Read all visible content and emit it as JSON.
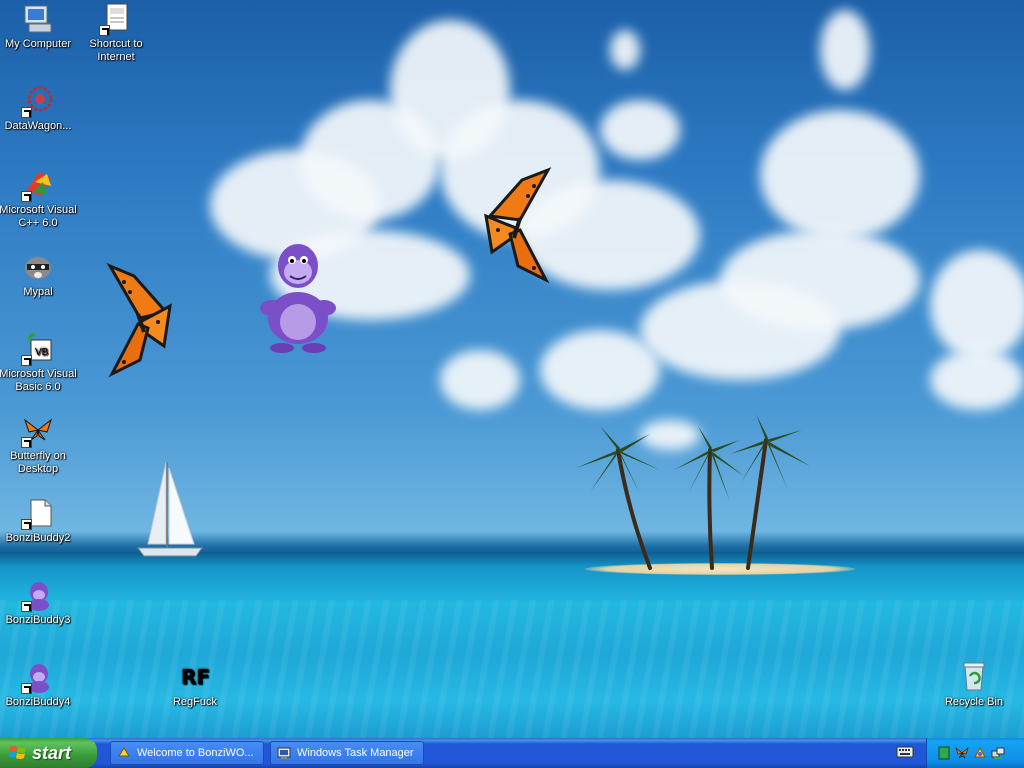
{
  "desktop_icons": [
    {
      "id": "my-computer",
      "label": "My Computer",
      "icon": "computer-icon",
      "shortcut": false
    },
    {
      "id": "shortcut-internet",
      "label": "Shortcut to Internet",
      "icon": "document-icon",
      "shortcut": true
    },
    {
      "id": "datawagon",
      "label": "DataWagon...",
      "icon": "datawagon-icon",
      "shortcut": true
    },
    {
      "id": "msvc",
      "label": "Microsoft Visual C++ 6.0",
      "icon": "visual-cpp-icon",
      "shortcut": true
    },
    {
      "id": "mypal",
      "label": "Mypal",
      "icon": "raccoon-icon",
      "shortcut": false
    },
    {
      "id": "msvb",
      "label": "Microsoft Visual Basic 6.0",
      "icon": "visual-basic-icon",
      "shortcut": true
    },
    {
      "id": "butterfly",
      "label": "Butterfly on Desktop",
      "icon": "butterfly-icon",
      "shortcut": true
    },
    {
      "id": "bonzi2",
      "label": "BonziBuddy2",
      "icon": "file-icon",
      "shortcut": true
    },
    {
      "id": "bonzi3",
      "label": "BonziBuddy3",
      "icon": "bonzi-icon",
      "shortcut": true
    },
    {
      "id": "bonzi4",
      "label": "BonziBuddy4",
      "icon": "bonzi-icon",
      "shortcut": true
    },
    {
      "id": "regfuck",
      "label": "RegFuck",
      "icon": "regfuck-icon",
      "shortcut": false
    },
    {
      "id": "recycle",
      "label": "Recycle Bin",
      "icon": "recycle-bin-icon",
      "shortcut": false
    }
  ],
  "regfuck_logo_text": "RF",
  "taskbar": {
    "start_label": "start",
    "tasks": [
      {
        "label": "Welcome to BonziWO...",
        "icon": "bonzi-app-icon"
      },
      {
        "label": "Windows Task Manager",
        "icon": "task-manager-icon"
      }
    ],
    "tray_icons": [
      "green-status-icon",
      "butterfly-tray-icon",
      "bonzi-tray-icon",
      "network-tray-icon"
    ]
  },
  "colors": {
    "taskbar_blue": "#2157d7",
    "start_green": "#3a9a3a",
    "tray_blue": "#0f8de8"
  }
}
